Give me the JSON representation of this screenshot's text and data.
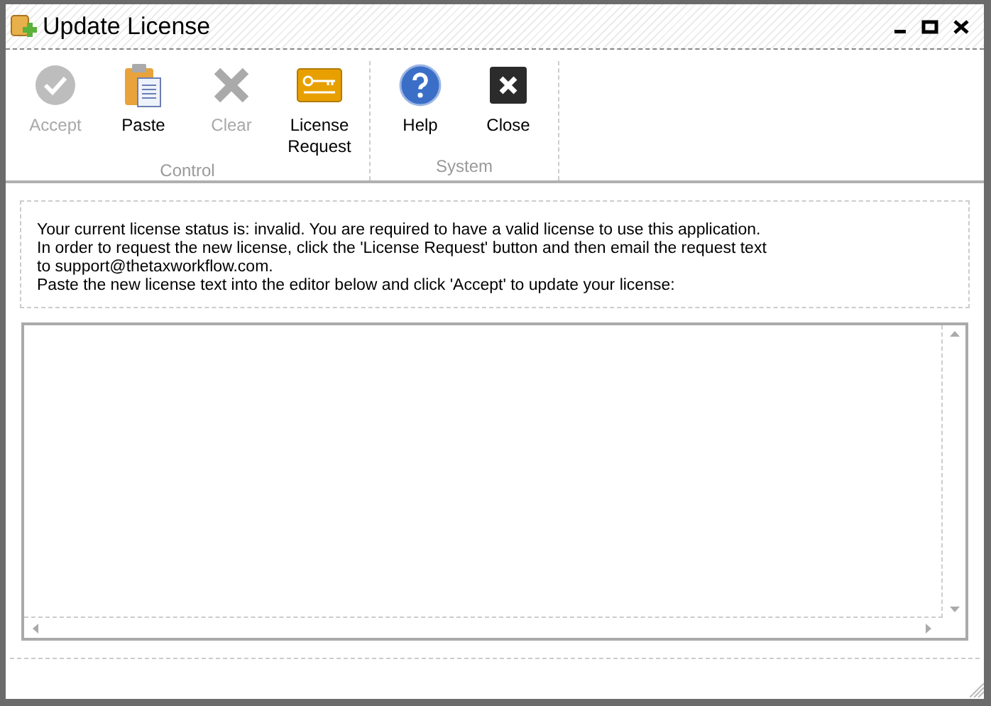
{
  "window": {
    "title": "Update License"
  },
  "ribbon_groups": [
    {
      "label": "Control",
      "buttons": [
        {
          "kind": "accept",
          "label": "Accept",
          "disabled": true
        },
        {
          "kind": "paste",
          "label": "Paste",
          "disabled": false
        },
        {
          "kind": "clear",
          "label": "Clear",
          "disabled": true
        },
        {
          "kind": "license",
          "label": "License Request",
          "disabled": false
        }
      ]
    },
    {
      "label": "System",
      "buttons": [
        {
          "kind": "help",
          "label": "Help",
          "disabled": false
        },
        {
          "kind": "close",
          "label": "Close",
          "disabled": false
        }
      ]
    }
  ],
  "message_lines": [
    "Your current license status is: invalid. You are required to have a valid license to use this application.",
    "In order to request the new license, click the 'License Request' button and then email the request text to support@thetaxworkflow.com.",
    "Paste the new license text into the editor below and click 'Accept' to update your license:"
  ]
}
